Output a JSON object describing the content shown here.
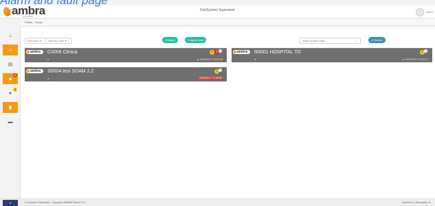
{
  "overlay_title": "Alarm and fault page",
  "header": {
    "logo_text": "ambra",
    "logo_sub": "SISTEMI",
    "app_title": "CrioSystem Supervisor",
    "user_name": "ambra"
  },
  "breadcrumb": "Plants - Faults",
  "sidebar": {
    "items": [
      {
        "name": "sidebar-item-network",
        "icon": "network-icon",
        "glyph": "⊥",
        "active": false
      },
      {
        "name": "sidebar-item-home",
        "icon": "home-icon",
        "glyph": "⌂",
        "active": true
      },
      {
        "name": "sidebar-item-documents",
        "icon": "document-icon",
        "glyph": "▤",
        "active": false
      },
      {
        "name": "sidebar-item-alarms",
        "icon": "warning-icon",
        "glyph": "▲",
        "active": true,
        "badge": "3"
      },
      {
        "name": "sidebar-item-faults",
        "icon": "fault-icon",
        "glyph": "●",
        "active": false,
        "badge": "1"
      },
      {
        "name": "sidebar-item-devices",
        "icon": "device-icon",
        "glyph": "▮",
        "active": true
      },
      {
        "name": "sidebar-item-reports",
        "icon": "report-icon",
        "glyph": "▬",
        "active": false
      }
    ]
  },
  "toolbar": {
    "fault_type_label": "Fault type ▼ ×",
    "order_label": "order by Code ▼ ×",
    "history_label": "⟲ history",
    "legend_label": "? legend Level",
    "search_placeholder": "search by plant name",
    "refresh_label": "⟳ Refresh"
  },
  "cards": [
    {
      "logo": "ambra",
      "name": "C0006 Clinica",
      "sub": "●",
      "date": "▲ 05/06/2017 15:07:16",
      "alert": false,
      "badge_yellow": "1",
      "badge_red": "1",
      "badge_small": "1"
    },
    {
      "logo": "ambra",
      "name": "R0001  HOSPITAL TO",
      "sub": "●",
      "date": "▲ 05/06/2017 12:31:21",
      "alert": false,
      "badge_yellow": "1",
      "badge_red": "",
      "badge_small": "1"
    },
    {
      "logo": "ambra",
      "name": "S0004 test SDAM 2.2",
      "sub": "● ...",
      "date": "05/06/2017 13:06:58",
      "alert": true,
      "badge_yellow": "1",
      "badge_red": "",
      "badge_small": "1"
    }
  ],
  "footer": {
    "toggle": "◂",
    "text": "CrioSystem Supervisor - Copyright AMBRA Sistemi S.r.l.",
    "right": "Supervisor | Ecosystem ▼"
  },
  "colors": {
    "accent": "#f39c12",
    "card_bg": "#6f6f6f",
    "alert": "#e53935",
    "history_pill": "#2bbfa1",
    "refresh_pill": "#3c8dbc"
  }
}
